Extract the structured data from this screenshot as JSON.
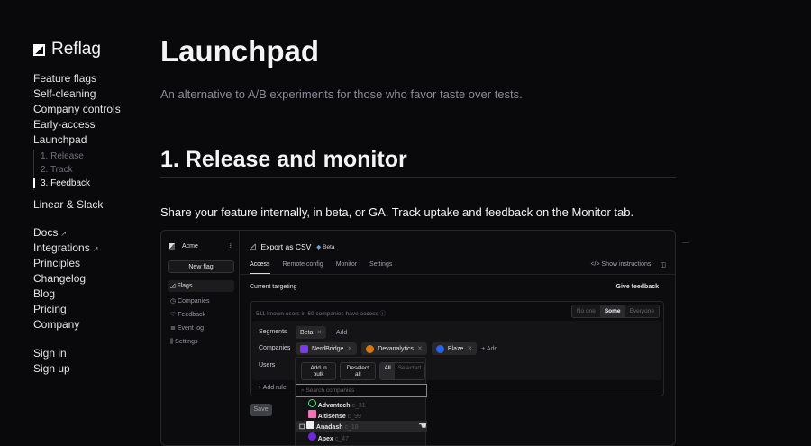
{
  "brand": "Reflag",
  "nav": [
    "Feature flags",
    "Self-cleaning",
    "Company controls",
    "Early-access",
    "Launchpad"
  ],
  "subnav": [
    "1. Release",
    "2. Track",
    "3. Feedback"
  ],
  "nav2": [
    "Linear & Slack"
  ],
  "nav3": [
    {
      "label": "Docs",
      "ext": "↗"
    },
    {
      "label": "Integrations",
      "ext": "↗"
    },
    {
      "label": "Principles"
    },
    {
      "label": "Changelog"
    },
    {
      "label": "Blog"
    },
    {
      "label": "Pricing"
    },
    {
      "label": "Company"
    }
  ],
  "auth": [
    "Sign in",
    "Sign up"
  ],
  "title": "Launchpad",
  "lead": "An alternative to A/B experiments for those who favor taste over tests.",
  "section": "1. Release and monitor",
  "para": "Share your feature internally, in beta, or GA. Track uptake and feedback on the Monitor tab.",
  "app": {
    "org": "Acme",
    "new_flag": "New flag",
    "menu": [
      "Flags",
      "Companies",
      "Feedback",
      "Event log",
      "Settings"
    ],
    "flag": "Export as CSV",
    "stage": "Beta",
    "tabs": [
      "Access",
      "Remote config",
      "Monitor",
      "Settings"
    ],
    "show_instructions": "Show instructions",
    "current_targeting": "Current targeting",
    "give_feedback": "Give feedback",
    "summary": "511 known users in 60 companies have access",
    "modes": [
      "No one",
      "Some",
      "Everyone"
    ],
    "segments_label": "Segments",
    "segment": "Beta",
    "add": "Add",
    "companies_label": "Companies",
    "companies": [
      "NerdBridge",
      "Devanalytics",
      "Blaze"
    ],
    "users_label": "Users",
    "add_bulk": "Add in bulk",
    "deselect": "Deselect all",
    "all": "All",
    "selected": "Selected",
    "search_placeholder": "Search companies",
    "results": [
      {
        "name": "Advantech",
        "id": "c_31"
      },
      {
        "name": "Altisense",
        "id": "c_99"
      },
      {
        "name": "Anadash",
        "id": "c_18"
      },
      {
        "name": "Apex",
        "id": "c_47"
      }
    ],
    "add_rule": "Add rule",
    "save": "Save"
  }
}
